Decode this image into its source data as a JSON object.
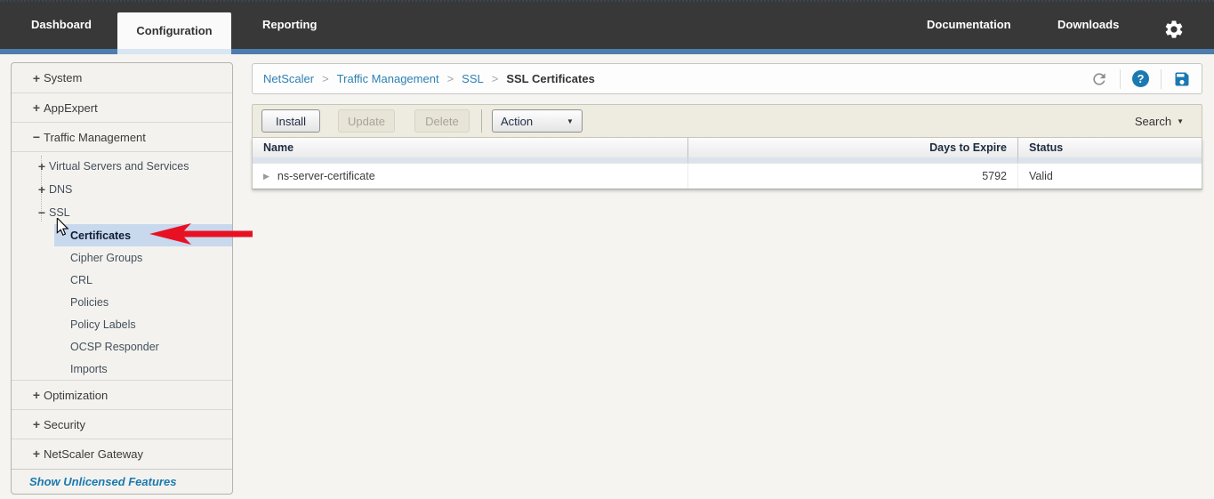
{
  "topnav": {
    "tabs": [
      {
        "label": "Dashboard",
        "active": false
      },
      {
        "label": "Configuration",
        "active": true
      },
      {
        "label": "Reporting",
        "active": false
      }
    ],
    "links": [
      {
        "label": "Documentation"
      },
      {
        "label": "Downloads"
      }
    ],
    "colors": {
      "bar": "#383838",
      "accent_strip": "#4c7dad",
      "active_tab_bg": "#fafafa"
    }
  },
  "sidebar": {
    "items": [
      {
        "label": "System",
        "expander": "+",
        "level": 1
      },
      {
        "label": "AppExpert",
        "expander": "+",
        "level": 1
      },
      {
        "label": "Traffic Management",
        "expander": "−",
        "level": 1
      },
      {
        "label": "Virtual Servers and Services",
        "expander": "+",
        "level": 2
      },
      {
        "label": "DNS",
        "expander": "+",
        "level": 2
      },
      {
        "label": "SSL",
        "expander": "−",
        "level": 2
      },
      {
        "label": "Certificates",
        "expander": "",
        "level": 3,
        "selected": true
      },
      {
        "label": "Cipher Groups",
        "expander": "",
        "level": 3
      },
      {
        "label": "CRL",
        "expander": "",
        "level": 3
      },
      {
        "label": "Policies",
        "expander": "",
        "level": 3
      },
      {
        "label": "Policy Labels",
        "expander": "",
        "level": 3
      },
      {
        "label": "OCSP Responder",
        "expander": "",
        "level": 3
      },
      {
        "label": "Imports",
        "expander": "",
        "level": 3
      },
      {
        "label": "Optimization",
        "expander": "+",
        "level": 1
      },
      {
        "label": "Security",
        "expander": "+",
        "level": 1
      },
      {
        "label": "NetScaler Gateway",
        "expander": "+",
        "level": 1
      }
    ],
    "footer_link": "Show Unlicensed Features",
    "selected_bg": "#c8d8ed"
  },
  "breadcrumb": {
    "items": [
      {
        "label": "NetScaler"
      },
      {
        "label": "Traffic Management"
      },
      {
        "label": "SSL"
      }
    ],
    "current": "SSL Certificates",
    "separator": ">"
  },
  "toolbar": {
    "install_label": "Install",
    "update_label": "Update",
    "delete_label": "Delete",
    "action_label": "Action",
    "search_label": "Search"
  },
  "table": {
    "columns": [
      "Name",
      "Days to Expire",
      "Status"
    ],
    "rows": [
      {
        "name": "ns-server-certificate",
        "days_to_expire": "5792",
        "status": "Valid"
      }
    ]
  },
  "icons": {
    "help_glyph": "?",
    "caret_down": "▼",
    "row_expander": "▶"
  },
  "annotation": {
    "arrow_color": "#e81123"
  }
}
